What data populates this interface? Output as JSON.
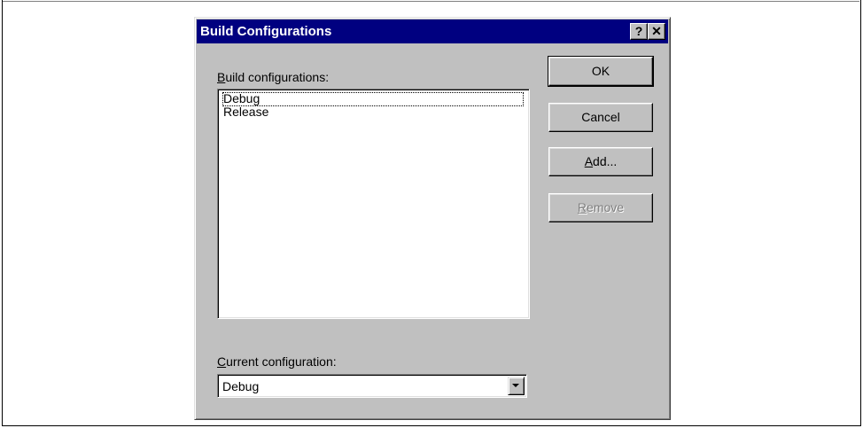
{
  "dialog": {
    "title": "Build Configurations",
    "help_glyph": "?",
    "close_glyph": "✕"
  },
  "build_configs": {
    "label_mnemonic": "B",
    "label_rest": "uild configurations:",
    "items": [
      "Debug",
      "Release"
    ],
    "focused_index": 0
  },
  "current_config": {
    "label_mnemonic": "C",
    "label_rest": "urrent configuration:",
    "value": "Debug"
  },
  "buttons": {
    "ok": "OK",
    "cancel": "Cancel",
    "add_mnemonic": "A",
    "add_rest": "dd...",
    "remove_mnemonic": "R",
    "remove_rest": "emove"
  },
  "colors": {
    "titlebar": "#000080",
    "face": "#c0c0c0"
  }
}
